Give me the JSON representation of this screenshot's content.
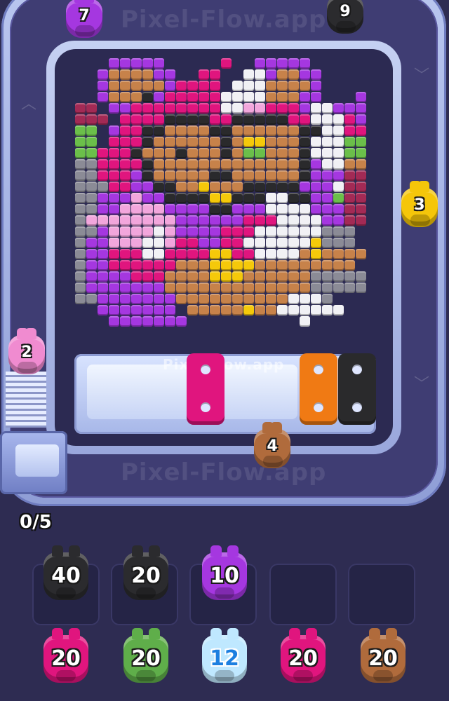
{
  "watermark": "Pixel-Flow.app",
  "tray_watermark": "Pixel-flow.app",
  "counter": "0/5",
  "track_pigs": [
    {
      "id": "top-purple",
      "value": "7",
      "color": "#a537e0"
    },
    {
      "id": "top-black",
      "value": "9",
      "color": "#2b2b2e"
    },
    {
      "id": "right-yellow",
      "value": "3",
      "color": "#f5c60a"
    },
    {
      "id": "left-pink",
      "value": "2",
      "color": "#f08bd0"
    },
    {
      "id": "bottom-brown",
      "value": "4",
      "color": "#b06b3c"
    }
  ],
  "holders": [
    {
      "color": "#e0157e"
    },
    {
      "color": "#f07a14"
    },
    {
      "color": "#2a2a2c"
    }
  ],
  "queue_row1": [
    {
      "value": "40",
      "color": "#2b2b2e"
    },
    {
      "value": "20",
      "color": "#2b2b2e"
    },
    {
      "value": "10",
      "color": "#a537e0"
    },
    {
      "value": "",
      "color": ""
    },
    {
      "value": "",
      "color": ""
    }
  ],
  "queue_row2": [
    {
      "value": "20",
      "color": "#e0157e"
    },
    {
      "value": "20",
      "color": "#5fae4a"
    },
    {
      "value": "12",
      "color": "#bfe8ff"
    },
    {
      "value": "20",
      "color": "#e0157e"
    },
    {
      "value": "20",
      "color": "#b06b3c"
    }
  ],
  "palette": {
    "k": "#2a2a2c",
    "p": "#e0157e",
    "v": "#a537e0",
    "o": "#c7824a",
    "w": "#f1f1f5",
    "g": "#8b8b96",
    "y": "#f5c90a",
    "l": "#f2a6dc",
    "G": "#6bbf4a",
    "r": "#a32a55",
    "m": "#c25ad6",
    ".": ""
  },
  "pixel_rows": [
    "...vvvvv.....p..vvvvv......",
    "..voooovv..pp..wwvoovv.....",
    "..vooooovpppp.wwwoooov.....",
    "..voookvpppppwwwwooovv...v.",
    "rr.vvppppppppwwllpppvwwvvv.",
    "rrr.ppppkkkkppkkkkkppwwwpv.",
    "GG.vppkkooookkooooookkwwpp.",
    "GG.pppkooooookoyyoookwwwGG.",
    "GGpppkoookoookoGGoookwwwGG.",
    "ggppppkoooooooooooookvwwoo.",
    "ggpppvkoooookkooooookvvvrr.",
    "gggppvvkkooyoookkkkkvvvwrr.",
    "ggvvvlvvkkkkyykkkwwkkvvGrr.",
    "ggvvllllvvvvkkvvvwwwwvvvrr.",
    "gllllllllvvvvvvpppwwwwvvrr.",
    "ggvllllwlvvvvpppwwwwwwggg..",
    "gvvlllwwlppvvppwwwwwwyggg..",
    "gvvpppwwppppyyppwwwwoyoooo.",
    "gvvppppppoooyyyyooooooooo..",
    "gvvvvpppooooyyyooooooggggg.",
    "gvvvvvvvoooooooooooooggggg.",
    "ggvvvvvvvoooooooooowwwg....",
    "..vvvvvvv.oooooyoowwwwww...",
    "...vvvvvvv..........w......"
  ]
}
